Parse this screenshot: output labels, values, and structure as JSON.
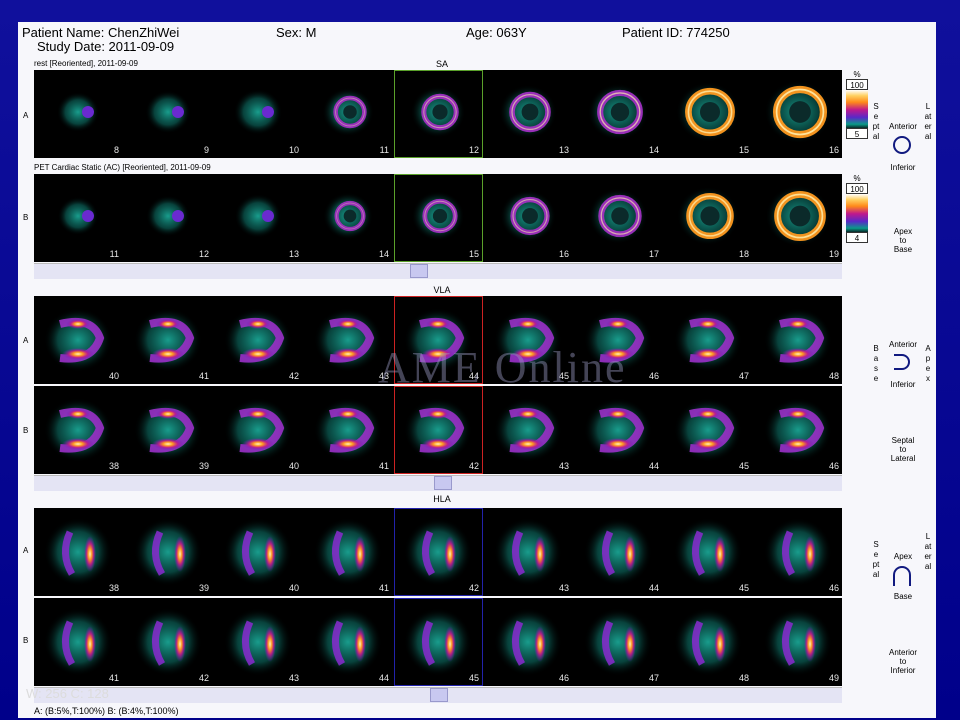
{
  "header": {
    "patient_name": "Patient Name: ChenZhiWei",
    "study_date": "Study Date: 2011-09-09",
    "sex": "Sex: M",
    "age": "Age: 063Y",
    "patient_id": "Patient ID: 774250"
  },
  "series_a_title": "rest [Reoriented], 2011-09-09",
  "series_b_title": "PET Cardiac Static (AC) [Reoriented], 2011-09-09",
  "views": {
    "sa": "SA",
    "vla": "VLA",
    "hla": "HLA"
  },
  "row_labels": {
    "a": "A",
    "b": "B"
  },
  "sa": {
    "row_a": [
      "8",
      "9",
      "10",
      "11",
      "12",
      "13",
      "14",
      "15",
      "16"
    ],
    "row_b": [
      "11",
      "12",
      "13",
      "14",
      "15",
      "16",
      "17",
      "18",
      "19"
    ],
    "colorbar_a": {
      "pct": "%",
      "max": "100",
      "min": "5"
    },
    "colorbar_b": {
      "pct": "%",
      "max": "100",
      "min": "4"
    }
  },
  "vla": {
    "row_a": [
      "40",
      "41",
      "42",
      "43",
      "44",
      "45",
      "46",
      "47",
      "48"
    ],
    "row_b": [
      "38",
      "39",
      "40",
      "41",
      "42",
      "43",
      "44",
      "45",
      "46"
    ]
  },
  "hla": {
    "row_a": [
      "38",
      "39",
      "40",
      "41",
      "42",
      "43",
      "44",
      "45",
      "46"
    ],
    "row_b": [
      "41",
      "42",
      "43",
      "44",
      "45",
      "46",
      "47",
      "48",
      "49"
    ]
  },
  "orient": {
    "sa_anterior": "Anterior",
    "sa_inferior": "Inferior",
    "sa_left": "Septal",
    "sa_right": "Lateral",
    "apex_to_base": [
      "Apex",
      "to",
      "Base"
    ],
    "vla_anterior": "Anterior",
    "vla_inferior": "Inferior",
    "vla_left": "Base",
    "vla_right": "Apex",
    "septal_to_lateral": [
      "Septal",
      "to",
      "Lateral"
    ],
    "hla_apex": "Apex",
    "hla_base": "Base",
    "hla_left": "Septal",
    "hla_right": "Lateral",
    "anterior_to_inferior": [
      "Anterior",
      "to",
      "Inferior"
    ]
  },
  "window_level": "W: 256  C: 128",
  "footer": "A: (B:5%,T:100%)    B: (B:4%,T:100%)",
  "watermark": "AME Online",
  "colors": {
    "sa_frame": "#5aa02a",
    "vla_frame": "#cc2222",
    "hla_frame": "#2222aa"
  }
}
